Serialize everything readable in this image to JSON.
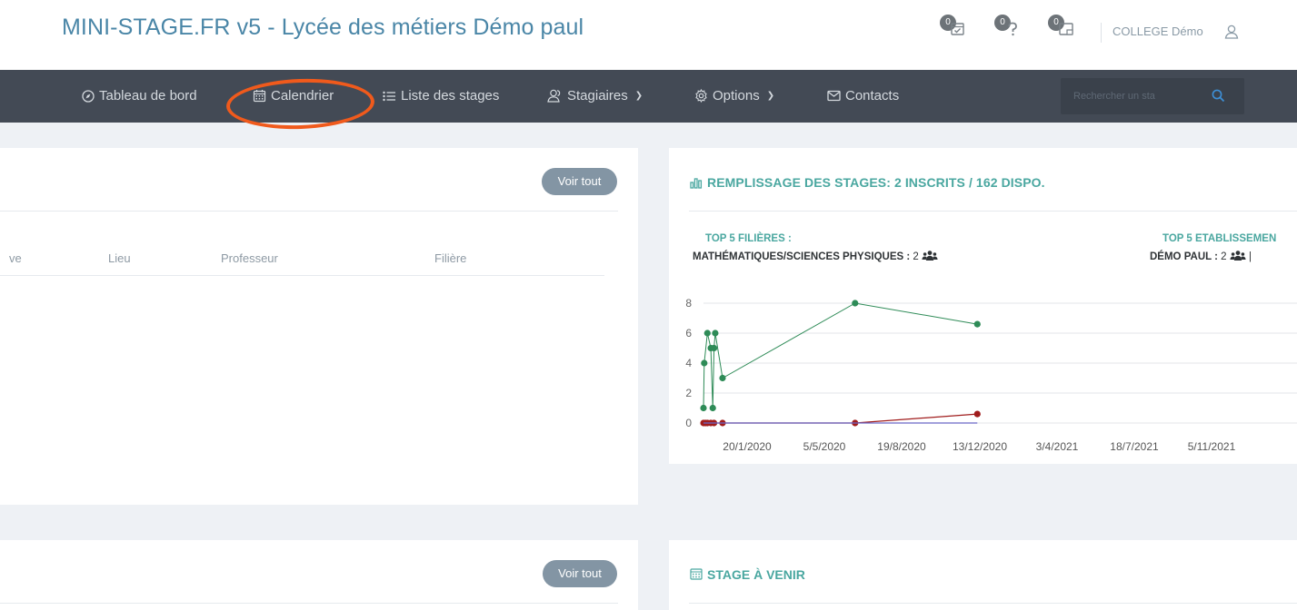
{
  "header": {
    "title": "MINI-STAGE.FR v5 - Lycée des métiers Démo paul",
    "notifications": [
      {
        "count": "0",
        "icon": "calendar-check-icon"
      },
      {
        "count": "0",
        "icon": "question-icon"
      },
      {
        "count": "0",
        "icon": "window-icon"
      }
    ],
    "user_name": "COLLEGE Démo"
  },
  "nav": {
    "items": [
      {
        "label": "Tableau de bord",
        "icon": "compass-icon"
      },
      {
        "label": "Calendrier",
        "icon": "calendar-icon"
      },
      {
        "label": "Liste des stages",
        "icon": "list-icon"
      },
      {
        "label": "Stagiaires",
        "icon": "users-icon"
      },
      {
        "label": "Options",
        "icon": "gear-icon"
      },
      {
        "label": "Contacts",
        "icon": "envelope-icon"
      }
    ],
    "search_placeholder": "Rechercher un sta",
    "highlight_color": "#f05a1c"
  },
  "left_panel": {
    "voir_tout_label": "Voir tout",
    "columns": [
      "ve",
      "Lieu",
      "Professeur",
      "Filière"
    ]
  },
  "stats_panel": {
    "title": "REMPLISSAGE DES STAGES: 2 INSCRITS / 162 DISPO.",
    "top_filieres_label": "TOP 5 FILIÈRES :",
    "top_filieres_value": "MATHÉMATIQUES/SCIENCES PHYSIQUES :",
    "top_filieres_count": "2",
    "top_etab_label": "TOP 5 ETABLISSEMEN",
    "top_etab_value": "DÉMO PAUL :",
    "top_etab_count": "2",
    "top_etab_sep": "|"
  },
  "lower_left_panel": {
    "voir_tout_label": "Voir tout"
  },
  "upcoming_panel": {
    "title": "STAGE À VENIR"
  },
  "chart_data": {
    "type": "line",
    "x_tick_labels": [
      "20/1/2020",
      "5/5/2020",
      "19/8/2020",
      "13/12/2020",
      "3/4/2021",
      "18/7/2021",
      "5/11/2021"
    ],
    "y_tick_labels": [
      "0",
      "2",
      "4",
      "6",
      "8"
    ],
    "ylim": [
      0,
      8
    ],
    "grid": true,
    "series": [
      {
        "color": "#2e8b57",
        "points": [
          [
            0.0,
            1
          ],
          [
            0.3,
            4
          ],
          [
            1.6,
            6
          ],
          [
            3.0,
            5
          ],
          [
            3.8,
            1
          ],
          [
            4.3,
            5
          ],
          [
            4.8,
            6
          ],
          [
            7.8,
            3
          ],
          [
            62.0,
            8
          ],
          [
            112.0,
            6.6
          ]
        ]
      },
      {
        "color": "#a01c1c",
        "points": [
          [
            0.0,
            0
          ],
          [
            0.8,
            0
          ],
          [
            1.6,
            0
          ],
          [
            3.0,
            0
          ],
          [
            4.3,
            0
          ],
          [
            7.8,
            0
          ],
          [
            62.0,
            0
          ],
          [
            112.0,
            0.6
          ]
        ]
      },
      {
        "color": "#6a67c8",
        "points": [
          [
            0.0,
            0
          ],
          [
            112.0,
            0
          ]
        ]
      }
    ]
  }
}
